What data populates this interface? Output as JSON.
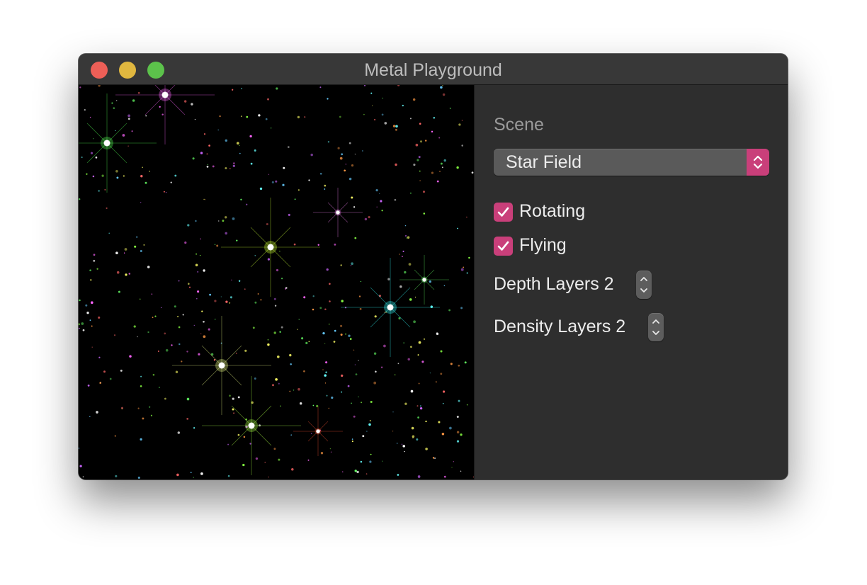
{
  "window": {
    "title": "Metal Playground"
  },
  "titlebar": {
    "close_icon": "close-icon",
    "minimize_icon": "minimize-icon",
    "zoom_icon": "zoom-icon",
    "colors": {
      "close": "#ed5f57",
      "minimize": "#e0b73f",
      "zoom": "#5cc24b"
    }
  },
  "viewport": {
    "description_icon": "starfield-render",
    "background": "#000000"
  },
  "sidebar": {
    "scene_label": "Scene",
    "scene_popup": {
      "selected": "Star Field",
      "icon": "chevron-up-down-icon"
    },
    "checkboxes": [
      {
        "label": "Rotating",
        "checked": true
      },
      {
        "label": "Flying",
        "checked": true
      }
    ],
    "steppers": [
      {
        "label": "Depth Layers 2"
      },
      {
        "label": "Density Layers 2"
      }
    ],
    "accent_color": "#c93f7a"
  }
}
